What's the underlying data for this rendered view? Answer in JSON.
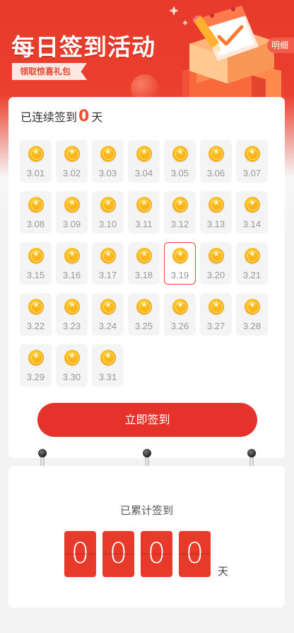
{
  "hero": {
    "title": "每日签到活动",
    "badge": "领取惊喜礼包",
    "detail_tab": "明细"
  },
  "sign": {
    "streak_prefix": "已连续签到",
    "streak_count": "0",
    "streak_unit": "天",
    "days": [
      "3.01",
      "3.02",
      "3.03",
      "3.04",
      "3.05",
      "3.06",
      "3.07",
      "3.08",
      "3.09",
      "3.10",
      "3.11",
      "3.12",
      "3.13",
      "3.14",
      "3.15",
      "3.16",
      "3.17",
      "3.18",
      "3.19",
      "3.20",
      "3.21",
      "3.22",
      "3.23",
      "3.24",
      "3.25",
      "3.26",
      "3.27",
      "3.28",
      "3.29",
      "3.30",
      "3.31"
    ],
    "today": "3.19",
    "button_label": "立即签到"
  },
  "total": {
    "label": "已累计签到",
    "digits": [
      "0",
      "0",
      "0",
      "0"
    ],
    "unit": "天"
  },
  "colors": {
    "brand_red": "#e73a2a",
    "button_red": "#e5332b",
    "streak_orange": "#f24f2c",
    "coin_gold": "#fbb51b"
  },
  "icons": [
    "calendar-illustration-icon",
    "pencil-icon",
    "check-icon",
    "coin-icon",
    "star-icon",
    "binder-ring-icon"
  ]
}
